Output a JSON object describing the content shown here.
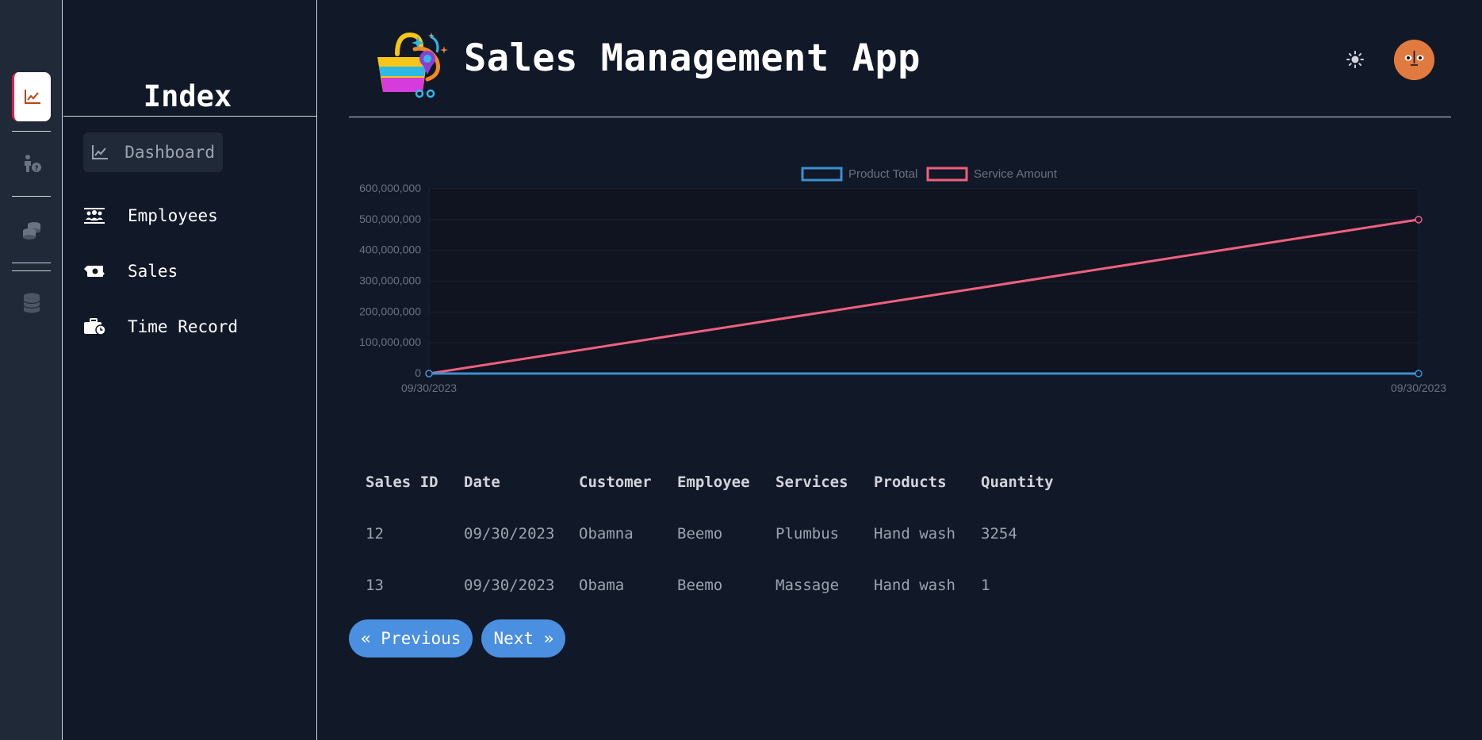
{
  "rail": {
    "items": [
      {
        "icon": "chart-line-icon",
        "active": true
      },
      {
        "icon": "person-question-icon",
        "active": false
      },
      {
        "icon": "coins-icon",
        "active": false
      },
      {
        "icon": "database-icon",
        "active": false
      }
    ],
    "accent": "#e11d48"
  },
  "sidebar": {
    "title": "Index",
    "items": [
      {
        "label": "Dashboard",
        "icon": "chart-line-icon",
        "active": true
      },
      {
        "label": "Employees",
        "icon": "users-icon",
        "active": false
      },
      {
        "label": "Sales",
        "icon": "money-exchange-icon",
        "active": false
      },
      {
        "label": "Time Record",
        "icon": "briefcase-clock-icon",
        "active": false
      }
    ]
  },
  "header": {
    "title": "Sales Management App",
    "logo": "shopping-bag-logo",
    "theme_icon": "sun-icon",
    "avatar_color": "#e07a3f"
  },
  "chart_data": {
    "type": "line",
    "x": [
      "09/30/2023",
      "09/30/2023"
    ],
    "series": [
      {
        "name": "Product Total",
        "values": [
          0,
          0
        ],
        "color": "#3b8fd1"
      },
      {
        "name": "Service Amount",
        "values": [
          0,
          500000000
        ],
        "color": "#f0607f"
      }
    ],
    "ylim": [
      0,
      600000000
    ],
    "yticks": [
      "0",
      "100,000,000",
      "200,000,000",
      "300,000,000",
      "400,000,000",
      "500,000,000",
      "600,000,000"
    ],
    "legend": "top-center",
    "grid": true
  },
  "table": {
    "headers": [
      "Sales ID",
      "Date",
      "Customer",
      "Employee",
      "Services",
      "Products",
      "Quantity"
    ],
    "rows": [
      [
        "12",
        "09/30/2023",
        "Obamna",
        "Beemo",
        "Plumbus",
        "Hand wash",
        "3254"
      ],
      [
        "13",
        "09/30/2023",
        "Obama",
        "Beemo",
        "Massage",
        "Hand wash",
        "1"
      ]
    ]
  },
  "pager": {
    "prev": "« Previous",
    "next": "Next »",
    "color": "#4a8fe0"
  }
}
